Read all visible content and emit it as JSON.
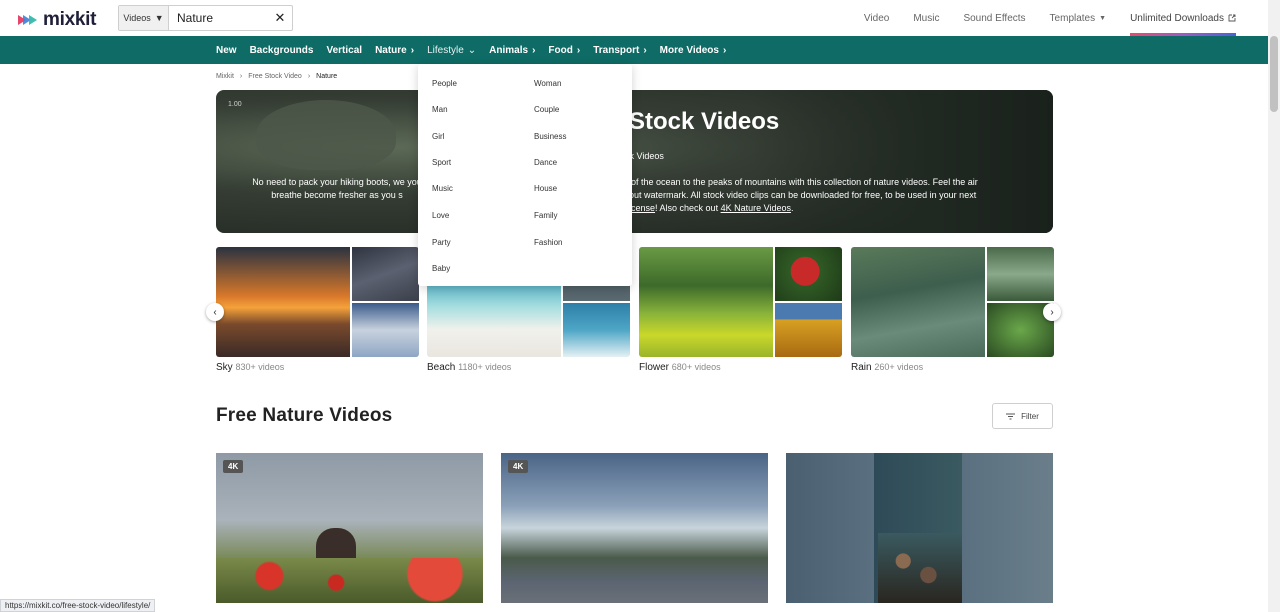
{
  "header": {
    "logo": "mixkit",
    "search": {
      "type": "Videos",
      "value": "Nature"
    },
    "nav": [
      "Video",
      "Music",
      "Sound Effects",
      "Templates",
      "Unlimited Downloads"
    ]
  },
  "navbar": {
    "items": [
      "New",
      "Backgrounds",
      "Vertical",
      "Nature",
      "Lifestyle",
      "Animals",
      "Food",
      "Transport",
      "More Videos"
    ]
  },
  "dropdown": {
    "left": [
      "People",
      "Man",
      "Girl",
      "Sport",
      "Music",
      "Love",
      "Party",
      "Baby"
    ],
    "right": [
      "Woman",
      "Couple",
      "Business",
      "Dance",
      "House",
      "Family",
      "Fashion"
    ]
  },
  "breadcrumb": [
    "Mixkit",
    "Free Stock Video",
    "Nature"
  ],
  "hero": {
    "rate": "1.00",
    "title": "Stock Videos",
    "subtitle": "ck Videos",
    "text_left": "No need to pack your hiking boots, we you breathe become fresher as you s",
    "text_right_1": "s of the ocean to the peaks of mountains with this collection of nature videos. Feel the air",
    "text_right_2": "hout watermark. All stock video clips can be downloaded for free, to be used in your next",
    "text_right_3a": "License",
    "text_right_3b": "! Also check out ",
    "text_right_3c": "4K Nature Videos",
    "text_right_3d": "."
  },
  "collections": [
    {
      "name": "Sky",
      "count": "830+ videos"
    },
    {
      "name": "Beach",
      "count": "1180+ videos"
    },
    {
      "name": "Flower",
      "count": "680+ videos"
    },
    {
      "name": "Rain",
      "count": "260+ videos"
    }
  ],
  "section": {
    "title": "Free Nature Videos",
    "filter": "Filter"
  },
  "cards": [
    {
      "badge": "4K"
    },
    {
      "badge": "4K"
    },
    {
      "badge": ""
    }
  ],
  "status_url": "https://mixkit.co/free-stock-video/lifestyle/",
  "colors": {
    "navbar": "#0e6b65",
    "accent_gradient": [
      "#e84a6a",
      "#9b5cc4",
      "#4a62d8"
    ]
  },
  "icons": [
    "logo-mark-icon",
    "caret-down-icon",
    "close-icon",
    "external-link-icon",
    "chevron-right-icon",
    "chevron-down-icon",
    "chevron-left-icon",
    "filter-icon"
  ]
}
